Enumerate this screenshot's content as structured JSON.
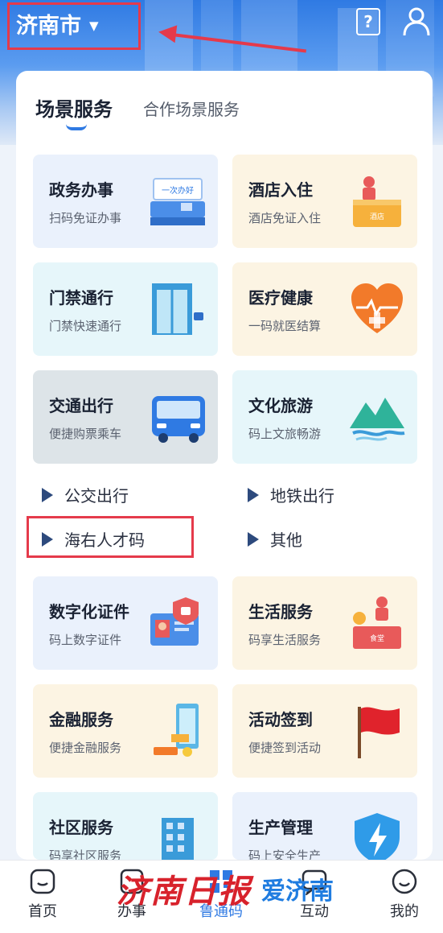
{
  "header": {
    "city": "济南市",
    "help_icon": "help-icon",
    "user_icon": "user-icon"
  },
  "tabs": [
    {
      "label": "场景服务",
      "active": true
    },
    {
      "label": "合作场景服务",
      "active": false
    }
  ],
  "tiles": [
    {
      "title": "政务办事",
      "subtitle": "扫码免证办事",
      "icon": "service-counter-icon",
      "icon_text": "一次办好"
    },
    {
      "title": "酒店入住",
      "subtitle": "酒店免证入住",
      "icon": "hotel-reception-icon",
      "icon_text": "酒店"
    },
    {
      "title": "门禁通行",
      "subtitle": "门禁快速通行",
      "icon": "door-gate-icon"
    },
    {
      "title": "医疗健康",
      "subtitle": "一码就医结算",
      "icon": "heart-icon"
    },
    {
      "title": "交通出行",
      "subtitle": "便捷购票乘车",
      "icon": "bus-icon"
    },
    {
      "title": "文化旅游",
      "subtitle": "码上文旅畅游",
      "icon": "mountain-icon"
    },
    {
      "title": "数字化证件",
      "subtitle": "码上数字证件",
      "icon": "id-card-icon"
    },
    {
      "title": "生活服务",
      "subtitle": "码享生活服务",
      "icon": "grocery-icon",
      "icon_text": "食堂"
    },
    {
      "title": "金融服务",
      "subtitle": "便捷金融服务",
      "icon": "finance-icon"
    },
    {
      "title": "活动签到",
      "subtitle": "便捷签到活动",
      "icon": "flag-icon"
    },
    {
      "title": "社区服务",
      "subtitle": "码享社区服务",
      "icon": "building-icon"
    },
    {
      "title": "生产管理",
      "subtitle": "码上安全生产",
      "icon": "shield-bolt-icon"
    }
  ],
  "transport_sub": [
    "公交出行",
    "地铁出行",
    "海右人才码",
    "其他"
  ],
  "bottom_nav": [
    {
      "label": "首页",
      "icon": "home-icon"
    },
    {
      "label": "办事",
      "icon": "task-icon"
    },
    {
      "label": "鲁通码",
      "icon": "qr-code-icon",
      "active": true
    },
    {
      "label": "互动",
      "icon": "chat-icon"
    },
    {
      "label": "我的",
      "icon": "smile-icon"
    }
  ],
  "watermark": {
    "left": "济南日报",
    "right": "爱济南"
  },
  "colors": {
    "primary": "#2f7ae3",
    "highlight": "#e53a4b"
  }
}
